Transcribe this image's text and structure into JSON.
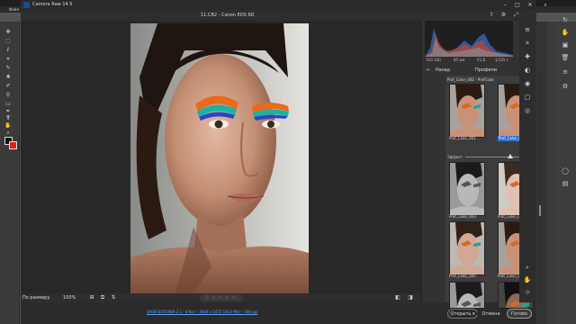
{
  "photoshop": {
    "title_short": "Файл",
    "right_icons": [
      "rotate-icon",
      "hand-icon",
      "camera-icon",
      "trash-icon",
      "list-icon",
      "settings-icon",
      "circle-icon",
      "palette-icon"
    ],
    "tools": [
      "move-icon",
      "marquee-icon",
      "lasso-icon",
      "crop-icon",
      "eyedropper-icon",
      "healing-icon",
      "brush-icon",
      "stamp-icon",
      "history-brush-icon",
      "eraser-icon",
      "gradient-icon",
      "blur-icon",
      "dodge-icon",
      "pen-icon",
      "type-icon",
      "path-icon",
      "shape-icon",
      "hand-icon",
      "zoom-icon"
    ],
    "colors": {
      "foreground": "#111111",
      "background": "#e02020"
    }
  },
  "camera_raw": {
    "window_title": "Camera Raw 14.5",
    "file_info": "11.CR2 - Canon EOS 6D",
    "zoom_label": "По размеру (16,3%)",
    "zoom_select": "100%",
    "rating_stars": "☆☆☆☆☆",
    "workflow_link": "sRGB IEC61966-2.1 - 8 бит - 3648 x 5472 (20,0 Мп) - 300 ppi",
    "buttons": {
      "open": "Открыть ▾",
      "cancel": "Отмена",
      "done": "Готово"
    }
  },
  "panel": {
    "exif": [
      "ISO 100",
      "85 мм",
      "f/1,8",
      "1/125 с"
    ],
    "back_label": "Назад",
    "profiles_label": "Профили",
    "selected_profile_title": "Prof_Color_002 - ProfColor",
    "effect_label": "Эффект",
    "effect_value": "100",
    "effect_value_fraction": 0.83,
    "thumbnails": [
      {
        "label": "Prof_Color_001",
        "tone": "color",
        "selected": false
      },
      {
        "label": "Prof_Color_002",
        "tone": "color",
        "selected": true
      },
      {
        "label": "Prof_Color_003",
        "tone": "mono",
        "selected": false
      },
      {
        "label": "Prof_Color_004",
        "tone": "light",
        "selected": false
      },
      {
        "label": "Prof_Color_005",
        "tone": "soft",
        "selected": false
      },
      {
        "label": "Prof_Color_006",
        "tone": "color",
        "selected": false
      },
      {
        "label": "",
        "tone": "mono",
        "selected": false
      },
      {
        "label": "",
        "tone": "dark",
        "selected": false
      }
    ]
  }
}
